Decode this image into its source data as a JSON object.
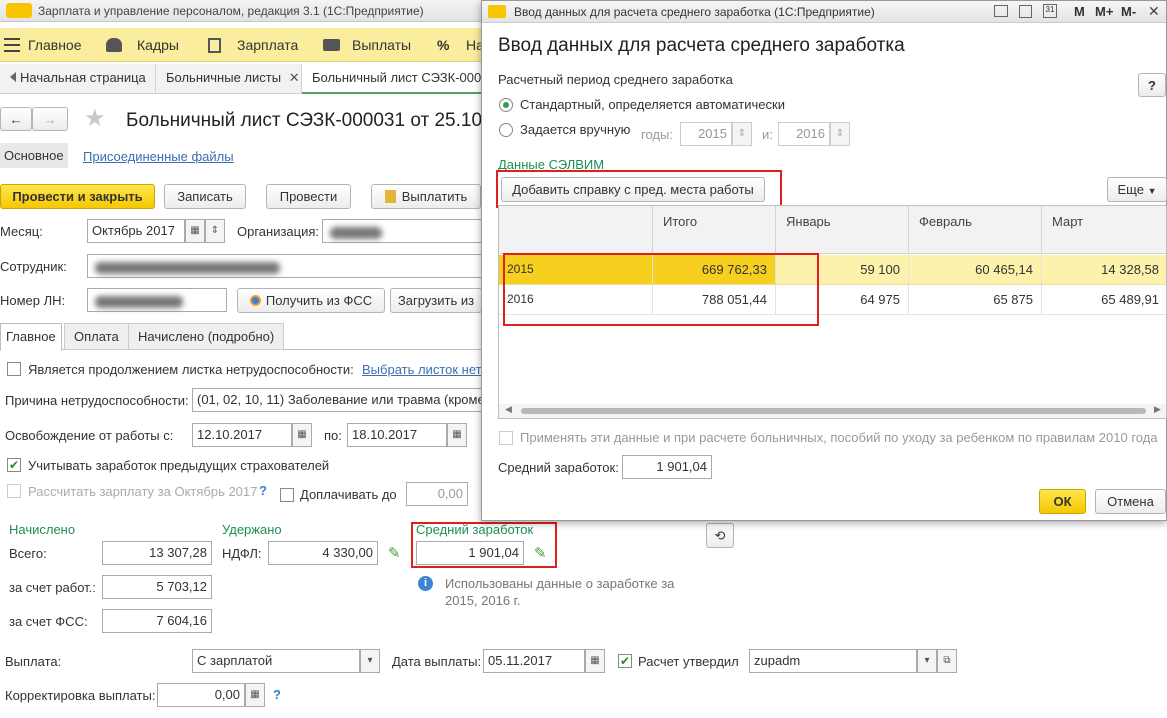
{
  "app": {
    "window_title": "Зарплата и управление персоналом, редакция 3.1  (1С:Предприятие)",
    "menu": [
      "Главное",
      "Кадры",
      "Зарплата",
      "Выплаты",
      "На"
    ],
    "tabs": [
      "Начальная страница",
      "Больничные листы",
      "Больничный лист СЭЗК-000"
    ]
  },
  "doc": {
    "title": "Больничный лист СЭЗК-000031 от 25.10",
    "subtabs": [
      "Основное",
      "Присоединенные файлы"
    ],
    "buttons": {
      "post_close": "Провести и закрыть",
      "save": "Записать",
      "post": "Провести",
      "pay": "Выплатить"
    },
    "month_label": "Месяц:",
    "month_value": "Октябрь 2017",
    "org_label": "Организация:",
    "employee_label": "Сотрудник:",
    "ln_label": "Номер ЛН:",
    "get_fss": "Получить из ФСС",
    "load_from": "Загрузить из",
    "inner_tabs": [
      "Главное",
      "Оплата",
      "Начислено (подробно)"
    ],
    "continuation_label": "Является продолжением листка нетрудоспособности:",
    "choose_link": "Выбрать листок нет",
    "reason_label": "Причина нетрудоспособности:",
    "reason_value": "(01, 02, 10, 11) Заболевание или травма (кроме",
    "release_label": "Освобождение от работы с:",
    "release_from": "12.10.2017",
    "release_to_label": "по:",
    "release_to": "18.10.2017",
    "prev_insurers": "Учитывать заработок предыдущих страхователей",
    "calc_salary": "Рассчитать зарплату за Октябрь 2017",
    "question": "?",
    "pay_upto": "Доплачивать до",
    "pay_upto_value": "0,00",
    "accrued_header": "Начислено",
    "withheld_header": "Удержано",
    "avg_header": "Средний заработок",
    "total_label": "Всего:",
    "total_value": "13 307,28",
    "ndfl_label": "НДФЛ:",
    "ndfl_value": "4 330,00",
    "avg_value": "1 901,04",
    "employer_label": "за счет работ.:",
    "employer_value": "5 703,12",
    "fss_label": "за счет ФСС:",
    "fss_value": "7 604,16",
    "info_text_1": "Использованы данные о заработке за",
    "info_text_2": "2015,  2016 г.",
    "payout_label": "Выплата:",
    "payout_value": "С зарплатой",
    "paydate_label": "Дата выплаты:",
    "paydate_value": "05.11.2017",
    "approved_label": "Расчет утвердил",
    "approved_value": "zupadm",
    "correction_label": "Корректировка выплаты:",
    "correction_value": "0,00"
  },
  "dialog": {
    "window_title": "Ввод данных для расчета среднего заработка  (1С:Предприятие)",
    "toolbar": [
      "M",
      "M+",
      "M-"
    ],
    "heading": "Ввод данных для расчета среднего заработка",
    "period_label": "Расчетный период среднего заработка",
    "help": "?",
    "radio_standard": "Стандартный, определяется автоматически",
    "radio_manual": "Задается вручную",
    "years_label": "годы:",
    "year_from": "2015",
    "and_label": "и:",
    "year_to": "2016",
    "data_label": "Данные СЭЛВИМ",
    "add_cert_button": "Добавить справку с пред. места работы",
    "more_button": "Еще",
    "columns": [
      "Итого",
      "Январь",
      "Февраль",
      "Март"
    ],
    "rows": [
      {
        "year": "2015",
        "total": "669 762,33",
        "jan": "59 100",
        "feb": "60 465,14",
        "mar": "14 328,58"
      },
      {
        "year": "2016",
        "total": "788 051,44",
        "jan": "64 975",
        "feb": "65 875",
        "mar": "65 489,91"
      }
    ],
    "apply_text": "Применять эти данные и при расчете больничных, пособий по уходу за ребенком по правилам 2010 года",
    "avg_label": "Средний заработок:",
    "avg_value": "1 901,04",
    "ok": "ОК",
    "cancel": "Отмена"
  },
  "colors": {
    "accent_yellow": "#f5c800",
    "green": "#1d8f55",
    "highlight": "#e02020",
    "menu_bg": "#fbed9e"
  }
}
